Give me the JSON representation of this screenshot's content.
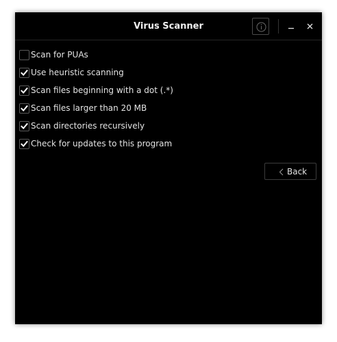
{
  "window": {
    "title": "Virus Scanner",
    "buttons": {
      "info": "info-icon",
      "minimize": "minimize-icon",
      "close": "close-icon"
    }
  },
  "options": [
    {
      "label": "Scan for PUAs",
      "checked": false
    },
    {
      "label": "Use heuristic scanning",
      "checked": true
    },
    {
      "label": "Scan files beginning with a dot (.*)",
      "checked": true
    },
    {
      "label": "Scan files larger than 20 MB",
      "checked": true
    },
    {
      "label": "Scan directories recursively",
      "checked": true
    },
    {
      "label": "Check for updates to this program",
      "checked": true
    }
  ],
  "back_button": {
    "label": "Back",
    "icon": "chevron-left-icon"
  },
  "colors": {
    "background": "#000000",
    "text": "#e4e4e4",
    "border": "#3c3c3c"
  }
}
